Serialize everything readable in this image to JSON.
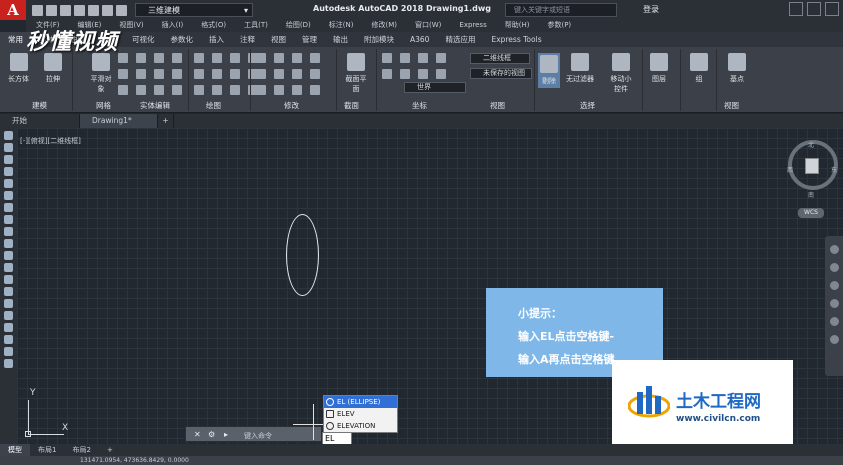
{
  "titlebar": {
    "app_letter": "A",
    "workspace": "三维建模",
    "title": "Autodesk AutoCAD 2018     Drawing1.dwg",
    "search_placeholder": "键入关键字或短语",
    "login": "登录"
  },
  "menus": [
    "文件(F)",
    "编辑(E)",
    "视图(V)",
    "插入(I)",
    "格式(O)",
    "工具(T)",
    "绘图(D)",
    "标注(N)",
    "修改(M)",
    "窗口(W)",
    "Express",
    "帮助(H)",
    "参数(P)"
  ],
  "ribbon_tabs": [
    "常用",
    "实体",
    "曲面",
    "网格",
    "可视化",
    "参数化",
    "插入",
    "注释",
    "视图",
    "管理",
    "输出",
    "附加模块",
    "A360",
    "精选应用",
    "Express Tools"
  ],
  "ribbon": {
    "buttons": {
      "box": "长方体",
      "extrude": "拉伸",
      "smooth": "平滑对象",
      "section_plane": "截面平面",
      "culling": "剔除",
      "no_filter": "无过滤器",
      "move_gizmo": "移动小控件",
      "layers": "图层",
      "groups": "组",
      "base": "基点"
    },
    "panels": [
      "建模",
      "网格",
      "实体编辑",
      "绘图",
      "修改",
      "截面",
      "坐标",
      "视图",
      "选择",
      "视图"
    ],
    "dropdowns": {
      "visual_style": "二维线框",
      "view_state": "未保存的视图",
      "ucs": "世界"
    }
  },
  "file_tabs": [
    "开始",
    "Drawing1*"
  ],
  "viewport_label": "[-][俯视][二维线框]",
  "viewcube": {
    "north": "北",
    "south": "南",
    "west": "西",
    "east": "东",
    "wcs": "WCS"
  },
  "ucs": {
    "x": "X",
    "y": "Y"
  },
  "tip": {
    "title": "小提示：",
    "line1": "输入EL点击空格键-",
    "line2": "输入A再点击空格键"
  },
  "autocomplete": {
    "items": [
      "EL (ELLIPSE)",
      "ELEV",
      "ELEVATION"
    ],
    "selected": 0,
    "typed": "EL"
  },
  "command_line": {
    "placeholder": "键入命令"
  },
  "layout_tabs": [
    "模型",
    "布局1",
    "布局2"
  ],
  "statusbar": {
    "coords": "131471.0954, 473636.8429, 0.0000"
  },
  "watermark": {
    "top_brand": "秒懂视频",
    "site_title": "土木工程网",
    "site_url": "www.civilcn.com"
  },
  "colors": {
    "canvas_bg": "#212830",
    "tip_bg": "#7fb8e8",
    "ac_selected": "#2f6fd6",
    "app_red": "#c8211e"
  }
}
